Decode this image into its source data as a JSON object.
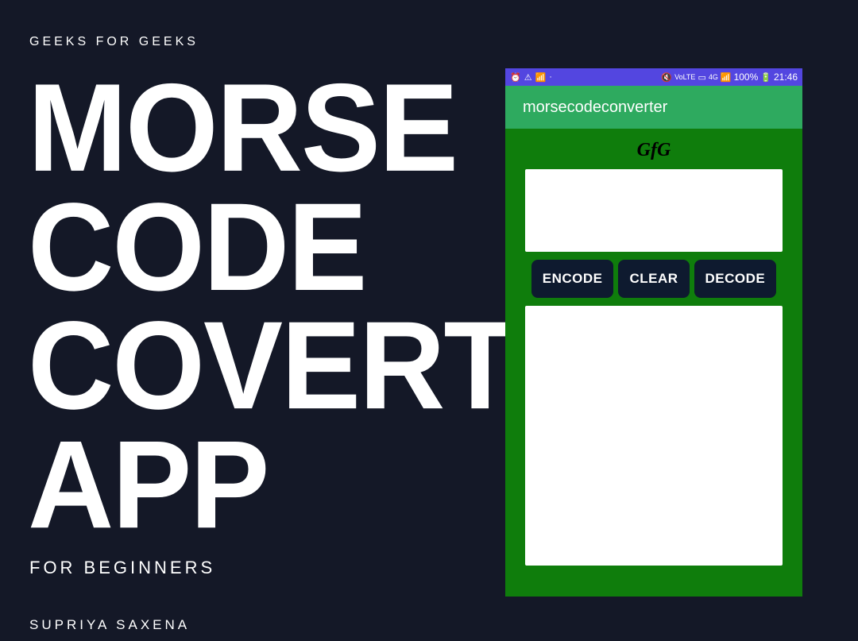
{
  "header": "GEEKS  FOR GEEKS",
  "title_line1": "MORSE",
  "title_line2": "CODE",
  "title_line3": "COVERTER",
  "title_line4": "APP",
  "subtitle": "FOR BEGINNERS",
  "author": "SUPRIYA SAXENA",
  "phone": {
    "status": {
      "battery": "100%",
      "time": "21:46"
    },
    "app_bar": "morsecodeconverter",
    "app_title": "GfG",
    "buttons": {
      "encode": "ENCODE",
      "clear": "CLEAR",
      "decode": "DECODE"
    }
  }
}
